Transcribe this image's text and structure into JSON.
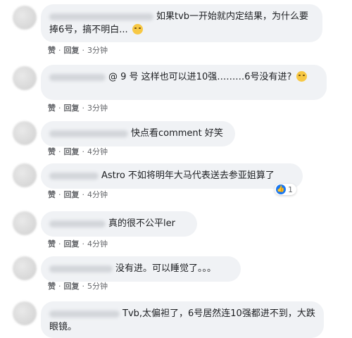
{
  "actions": {
    "like": "赞",
    "reply": "回复"
  },
  "comments": [
    {
      "text": "如果tvb一开始就内定结果，为什么要捧6号，搞不明白...",
      "emoji": "grinning-sweat-emoji",
      "time": "3分钟"
    },
    {
      "text": "@ 9 号 这样也可以进10强………6号没有进?",
      "emoji": "worried-face-emoji",
      "time": "3分钟"
    },
    {
      "text": "快点看comment 好笑",
      "time": "4分钟"
    },
    {
      "text": "Astro 不如将明年大马代表送去参亚姐算了",
      "time": "4分钟",
      "reactions": {
        "icon": "thumbs-up-icon",
        "count": "1"
      }
    },
    {
      "text": "真的很不公平ler",
      "time": "4分钟"
    },
    {
      "text": "没有进。可以睡觉了。。。",
      "time": "5分钟"
    },
    {
      "text": "Tvb,太偏袒了，6号居然连10强都进不到，大跌眼镜。"
    }
  ]
}
